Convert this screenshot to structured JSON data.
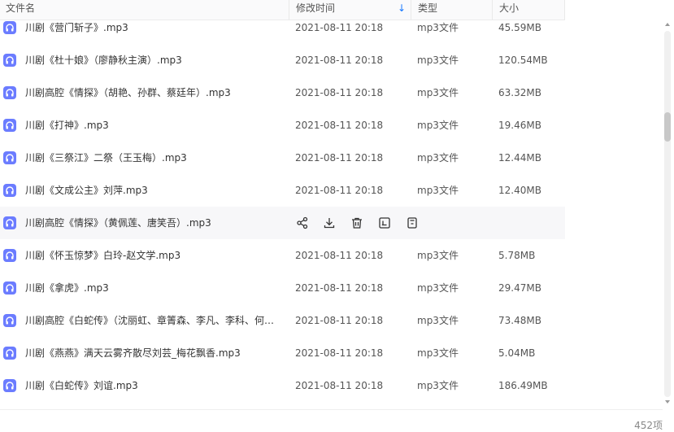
{
  "header": {
    "name_label": "文件名",
    "date_label": "修改时间",
    "type_label": "类型",
    "size_label": "大小",
    "sort_icon": "arrow-down-icon",
    "accent_color": "#1677ff"
  },
  "files": [
    {
      "name": "川剧《营门斩子》.mp3",
      "date": "2021-08-11 20:18",
      "type": "mp3文件",
      "size": "45.59MB"
    },
    {
      "name": "川剧《杜十娘》（廖静秋主演）.mp3",
      "date": "2021-08-11 20:18",
      "type": "mp3文件",
      "size": "120.54MB"
    },
    {
      "name": "川剧高腔《情探》（胡艳、孙群、蔡廷年）.mp3",
      "date": "2021-08-11 20:18",
      "type": "mp3文件",
      "size": "63.32MB"
    },
    {
      "name": "川剧《打神》.mp3",
      "date": "2021-08-11 20:18",
      "type": "mp3文件",
      "size": "19.46MB"
    },
    {
      "name": "川剧《三祭江》二祭（王玉梅）.mp3",
      "date": "2021-08-11 20:18",
      "type": "mp3文件",
      "size": "12.44MB"
    },
    {
      "name": "川剧《文成公主》刘萍.mp3",
      "date": "2021-08-11 20:18",
      "type": "mp3文件",
      "size": "12.40MB"
    },
    {
      "name": "川剧高腔《情探》（黄佩莲、唐笑吾）.mp3",
      "date": "",
      "type": "",
      "size": "",
      "hover": true
    },
    {
      "name": "川剧《怀玉惊梦》白玲-赵文学.mp3",
      "date": "2021-08-11 20:18",
      "type": "mp3文件",
      "size": "5.78MB"
    },
    {
      "name": "川剧《拿虎》.mp3",
      "date": "2021-08-11 20:18",
      "type": "mp3文件",
      "size": "29.47MB"
    },
    {
      "name": "川剧高腔《白蛇传》（沈丽虹、章箐森、李凡、李科、何…",
      "date": "2021-08-11 20:18",
      "type": "mp3文件",
      "size": "73.48MB"
    },
    {
      "name": "川剧《燕燕》满天云雾齐散尽刘芸_梅花飘香.mp3",
      "date": "2021-08-11 20:18",
      "type": "mp3文件",
      "size": "5.04MB"
    },
    {
      "name": "川剧《白蛇传》刘谊.mp3",
      "date": "2021-08-11 20:18",
      "type": "mp3文件",
      "size": "186.49MB"
    }
  ],
  "file_icon": "audio-file-icon",
  "file_icon_color": "#6b7cff",
  "hover_actions": [
    "share-icon",
    "download-icon",
    "delete-icon",
    "rename-icon",
    "more-icon"
  ],
  "footer": {
    "count": "452项"
  }
}
